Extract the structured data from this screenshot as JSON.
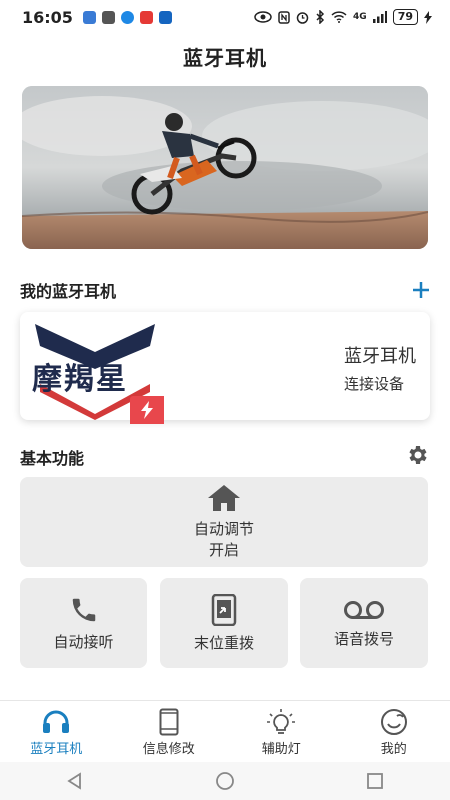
{
  "status_bar": {
    "time": "16:05",
    "battery": "79",
    "network": "4G"
  },
  "header": {
    "title": "蓝牙耳机"
  },
  "hero": {
    "image": "motocross-rider-jump"
  },
  "devices_section": {
    "title": "我的蓝牙耳机",
    "add_icon": "plus-icon"
  },
  "device_card": {
    "logo_text": "摩羯星",
    "name": "蓝牙耳机",
    "status": "连接设备"
  },
  "features_section": {
    "title": "基本功能",
    "settings_icon": "gear-icon"
  },
  "features": {
    "auto_adjust": {
      "title": "自动调节",
      "state": "开启",
      "icon": "home-icon"
    },
    "auto_answer": {
      "label": "自动接听",
      "icon": "phone-icon"
    },
    "redial": {
      "label": "末位重拨",
      "icon": "phone-forward-icon"
    },
    "voice_dial": {
      "label": "语音拨号",
      "icon": "voicemail-icon"
    }
  },
  "tabs": [
    {
      "label": "蓝牙耳机",
      "icon": "headphones-icon",
      "active": true
    },
    {
      "label": "信息修改",
      "icon": "tablet-icon",
      "active": false
    },
    {
      "label": "辅助灯",
      "icon": "lightbulb-icon",
      "active": false
    },
    {
      "label": "我的",
      "icon": "smiley-icon",
      "active": false
    }
  ],
  "colors": {
    "accent": "#1a7fbf",
    "tile_bg": "#ececec",
    "logo_navy": "#1f2b4d",
    "logo_red": "#d33a3a"
  }
}
